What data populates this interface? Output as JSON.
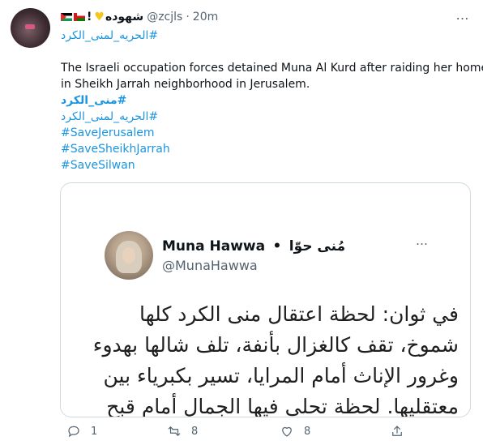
{
  "tweet": {
    "display_name": "شهوده",
    "handle": "@zcjls",
    "separator": "·",
    "time": "20m",
    "name_hashtag": "#الحريه_لمنى_الكرد",
    "body_line1": "The Israeli occupation forces detained Muna Al Kurd after raiding her home",
    "body_line2": "in Sheikh Jarrah neighborhood in Jerusalem.",
    "hashtags": [
      "#منى_الكرد",
      "#الحريه_لمنى_الكرد",
      "#SaveJerusalem",
      "#SaveSheikhJarrah",
      "#SaveSilwan"
    ],
    "more_icon": "…"
  },
  "embed": {
    "name": "Muna Hawwa",
    "dot": "•",
    "arabic_name": "مُنى حوّا",
    "handle": "@MunaHawwa",
    "more_icon": "…",
    "body": "في ثوان: لحظة اعتقال منى الكرد كلها شموخ، تقف كالغزال بأنفة، تلف شالها بهدوء وغرور الإناث أمام المرايا، تسير بكبرياء بين معتقليها. لحظة تحلى فيها الجمال أمام قبح"
  },
  "actions": {
    "reply_count": "1",
    "retweet_count": "8",
    "like_count": "8"
  },
  "colors": {
    "link": "#1b95e0",
    "secondary_text": "#536471",
    "border": "#cfd9de"
  }
}
